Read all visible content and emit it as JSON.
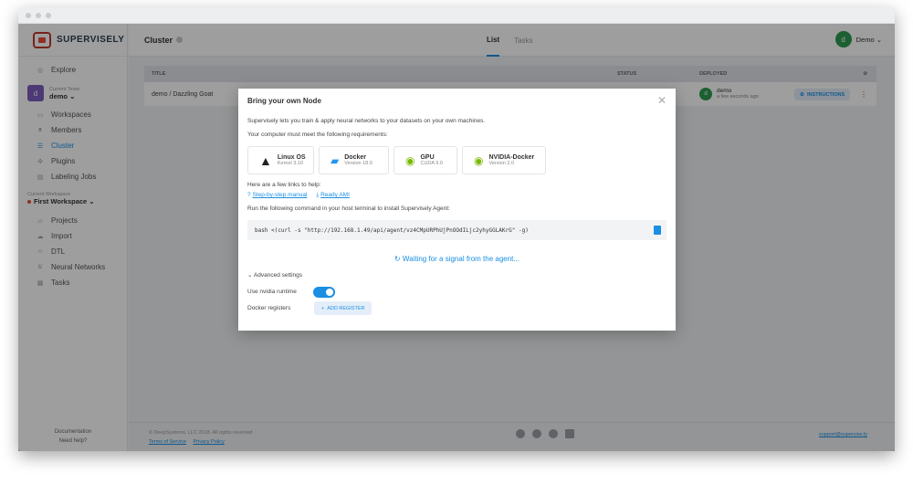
{
  "app": {
    "logo_text": "SUPERVISELY"
  },
  "sidebar": {
    "explore": "Explore",
    "team_label": "Current Team",
    "team_name": "demo ⌄",
    "team_avatar": "d",
    "team_items": [
      {
        "label": "Workspaces",
        "icon": "monitor-icon"
      },
      {
        "label": "Members",
        "icon": "users-icon"
      },
      {
        "label": "Cluster",
        "icon": "list-icon"
      },
      {
        "label": "Plugins",
        "icon": "puzzle-icon"
      },
      {
        "label": "Labeling Jobs",
        "icon": "clipboard-icon"
      }
    ],
    "workspace_label": "Current Workspace",
    "workspace_name": "First Workspace ⌄",
    "workspace_items": [
      {
        "label": "Projects",
        "icon": "folder-icon"
      },
      {
        "label": "Import",
        "icon": "cloud-upload-icon"
      },
      {
        "label": "DTL",
        "icon": "code-icon"
      },
      {
        "label": "Neural Networks",
        "icon": "neural-icon"
      },
      {
        "label": "Tasks",
        "icon": "tasks-icon"
      }
    ],
    "footer_docs": "Documentation",
    "footer_help": "Need help?"
  },
  "header": {
    "title": "Cluster",
    "tabs": [
      "List",
      "Tasks"
    ],
    "user_avatar": "d",
    "user_name": "Demo ⌄"
  },
  "table": {
    "columns": {
      "title": "TITLE",
      "status": "STATUS",
      "deployed": "DEPLOYED"
    },
    "rows": [
      {
        "title": "demo / Dazzling Goat",
        "deployed_by": "demo",
        "deployed_when": "a few seconds ago",
        "avatar": "d",
        "action": "INSTRUCTIONS"
      }
    ]
  },
  "footer": {
    "copyright": "© DeepSystems, LLC 2018. All rights reserved",
    "terms": "Terms of Service",
    "privacy": "Privacy Policy",
    "support": "support@supervise.ly"
  },
  "modal": {
    "title": "Bring your own Node",
    "intro": "Supervisely lets you train & apply neural networks to your datasets on your own machines.",
    "requirements_intro": "Your computer must meet the following requirements:",
    "requirements": [
      {
        "name": "Linux OS",
        "sub": "Kernel 3.10"
      },
      {
        "name": "Docker",
        "sub": "Version 18.0"
      },
      {
        "name": "GPU",
        "sub": "CUDA 9.0"
      },
      {
        "name": "NVIDIA-Docker",
        "sub": "Version 2.0"
      }
    ],
    "links_intro": "Here are a few links to help:",
    "link_manual": "Step-by-step manual",
    "link_ami": "Ready AMI",
    "command_intro": "Run the following command in your host terminal to install Supervisely Agent:",
    "command": "bash <(curl -s \"http://192.168.1.49/api/agent/vz4CMpURPhUjPnOOdILjc2yhyGGLAKrG\" -g)",
    "waiting": "Waiting for a signal from the agent...",
    "advanced": "⌄ Advanced settings",
    "nvidia_label": "Use nvidia runtime",
    "nvidia_on": true,
    "registers_label": "Docker registers",
    "add_register": "ADD REGISTER"
  }
}
